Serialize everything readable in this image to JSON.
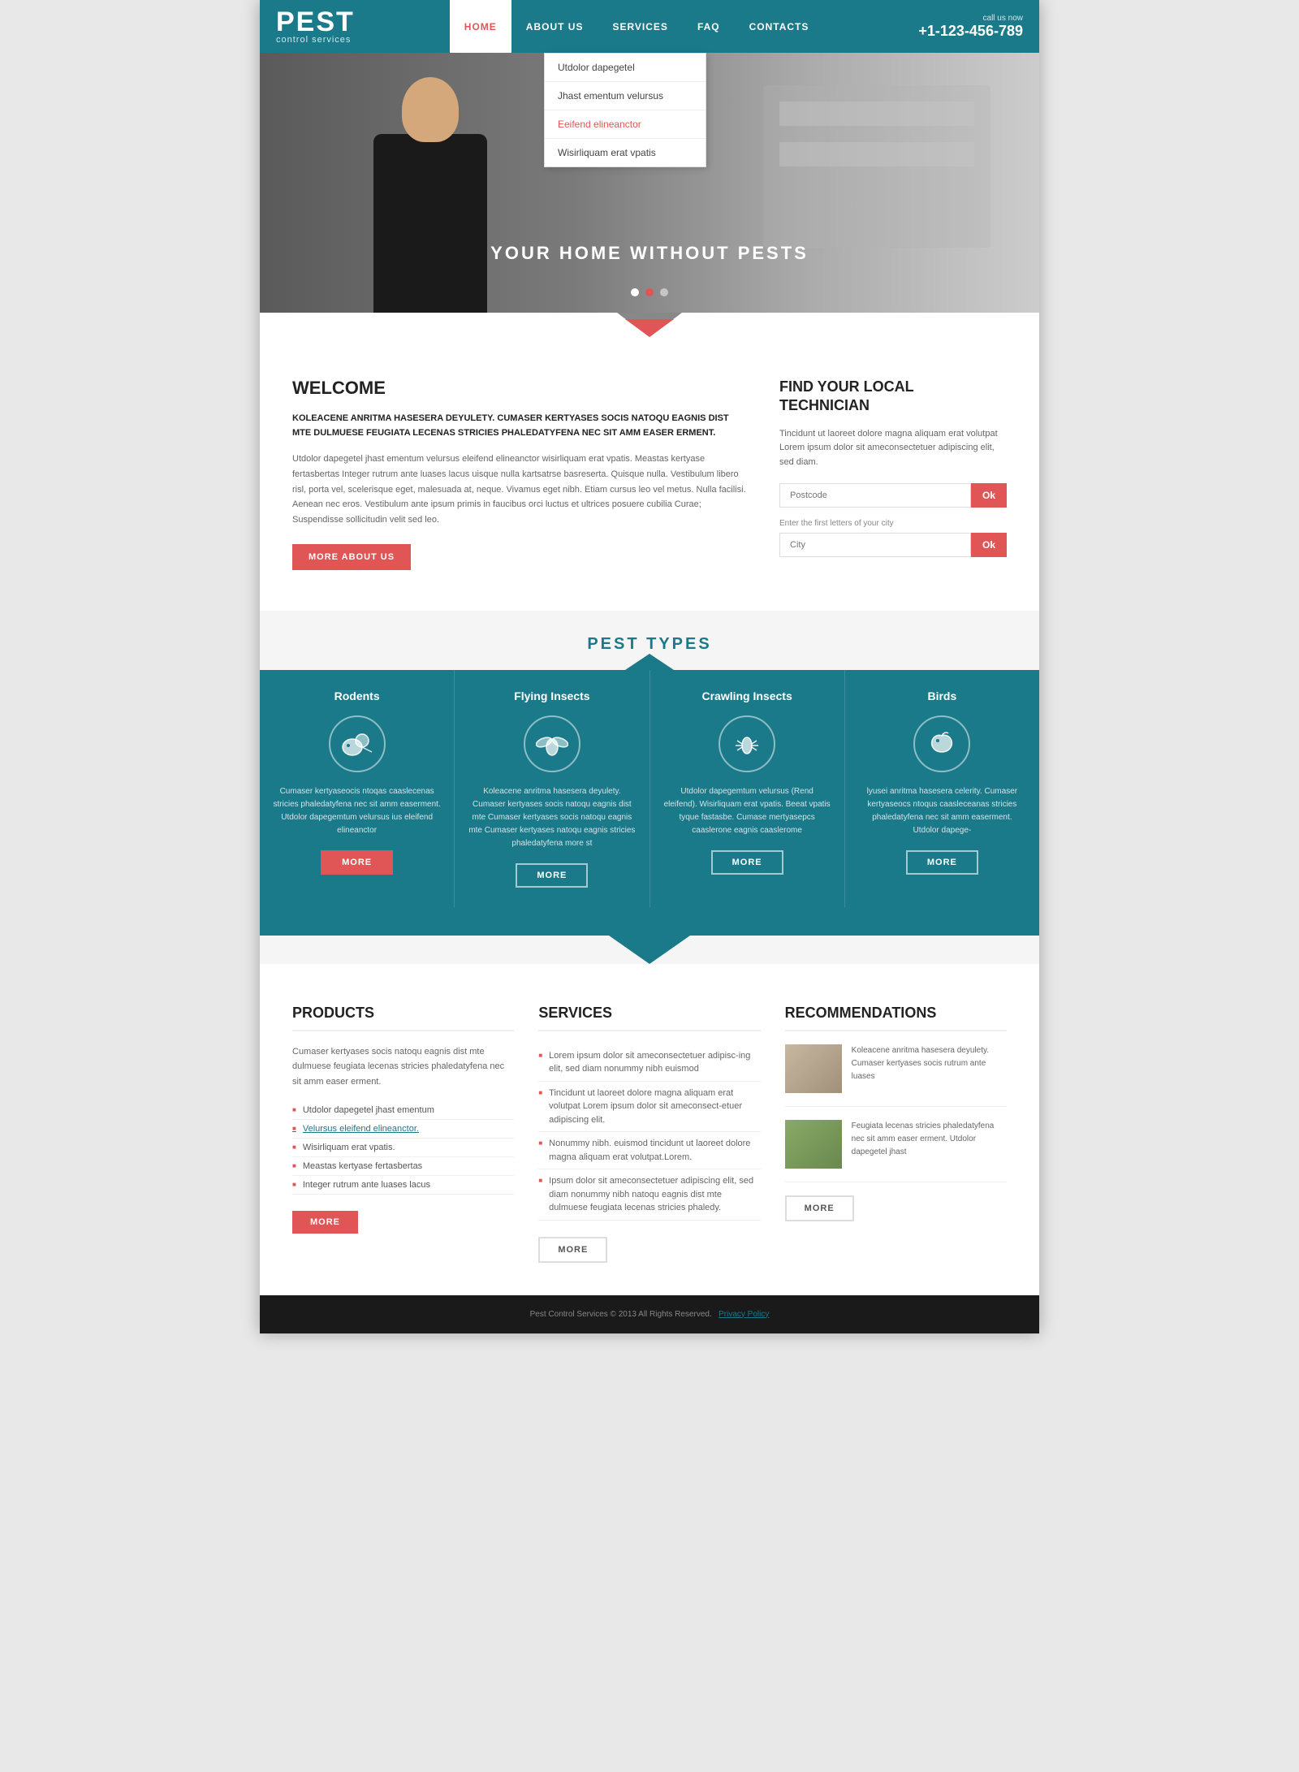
{
  "header": {
    "logo_pest": "PEST",
    "logo_sub": "control services",
    "call_us_label": "call us now",
    "phone": "+1-123-456-789",
    "nav": [
      {
        "label": "HOME",
        "active": true
      },
      {
        "label": "ABOUT US",
        "active": false
      },
      {
        "label": "SERVICES",
        "active": false
      },
      {
        "label": "FAQ",
        "active": false
      },
      {
        "label": "CONTACTS",
        "active": false
      }
    ]
  },
  "dropdown": {
    "items": [
      {
        "label": "Utdolor dapegetel",
        "active": false
      },
      {
        "label": "Jhast ementum velursus",
        "active": false
      },
      {
        "label": "Eeifend elineanctor",
        "active": true
      },
      {
        "label": "Wisirliquam erat vpatis",
        "active": false
      }
    ]
  },
  "hero": {
    "title": "YOUR HOME WITHOUT PESTS",
    "indicators": [
      true,
      false,
      false
    ]
  },
  "welcome": {
    "title": "WELCOME",
    "bold_text": "KOLEACENE ANRITMA HASESERA DEYULETY. CUMASER KERTYASES SOCIS NATOQU EAGNIS DIST MTE DULMUESE FEUGIATA LECENAS STRICIES PHALEDATYFENA NEC SIT AMM EASER ERMENT.",
    "body_text": "Utdolor dapegetel jhast ementum velursus eleifend elineanctor wisirliquam erat vpatis. Meastas kertyase fertasbertas Integer rutrum ante luases lacus uisque nulla kartsatrse basreserta. Quisque nulla. Vestibulum libero risl, porta vel, scelerisque eget, malesuada at, neque. Vivamus eget nibh. Etiam cursus leo vel metus. Nulla facilisi. Aenean nec eros. Vestibulum ante ipsum primis in faucibus orci luctus et ultrices posuere cubilia Curae; Suspendisse sollicitudin velit sed leo.",
    "btn_label": "MORE ABOUT US"
  },
  "find_technician": {
    "title": "FIND YOUR LOCAL TECHNICIAN",
    "body_text": "Tincidunt ut laoreet dolore magna aliquam erat volutpat Lorem ipsum dolor sit ameconsectetuer adipiscing elit, sed diam.",
    "postcode_placeholder": "Postcode",
    "btn_ok1": "Ok",
    "city_label": "Enter the first letters of your city",
    "city_placeholder": "City",
    "btn_ok2": "Ok"
  },
  "pest_types": {
    "section_title": "PEST TYPES",
    "pests": [
      {
        "name": "Rodents",
        "icon": "🐭",
        "desc": "Cumaser kertyaseocis ntoqas caaslecenas stricies phaledatyfena nec sit amm easerment. Utdolor dapegemtum velursus ius eleifend elineanctor",
        "btn": "MORE",
        "active": true
      },
      {
        "name": "Flying Insects",
        "icon": "🦟",
        "desc": "Koleacene anritma hasesera deyulety. Cumaser kertyases socis natoqu eagnis dist mte Cumaser kertyases socis natoqu eagnis mte Cumaser kertyases natoqu eagnis stricies phaledatyfena more st",
        "btn": "MORE",
        "active": false
      },
      {
        "name": "Crawling Insects",
        "icon": "🦗",
        "desc": "Utdolor dapegemtum velursus (Rend eleifend). Wisirliquam erat vpatis. Beeat vpatis tyque fastasbe. Cumase mertyasepcs caaslerone eagnis caaslerome",
        "btn": "MORE",
        "active": false
      },
      {
        "name": "Birds",
        "icon": "🐦",
        "desc": "lyusei anritma hasesera celerity. Cumaser kertyaseocs ntoqus caasleceanas stricies phaledatyfena nec sit amm easerment. Utdolor dapege-",
        "btn": "MORE",
        "active": false
      }
    ]
  },
  "products": {
    "title": "PRODUCTS",
    "intro_text": "Cumaser kertyases socis natoqu eagnis dist mte dulmuese feugiata lecenas stricies phaledatyfena nec sit amm easer erment.",
    "list_items": [
      {
        "text": "Utdolor dapegetel jhast ementum",
        "link": false
      },
      {
        "text": "Velursus eleifend elineanctor.",
        "link": true
      },
      {
        "text": "Wisirliquam erat vpatis.",
        "link": false
      },
      {
        "text": "Meastas kertyase fertasbertas",
        "link": false
      },
      {
        "text": "Integer rutrum ante luases lacus",
        "link": false
      }
    ],
    "btn_label": "MORE"
  },
  "services": {
    "title": "SERVICES",
    "list_items": [
      "Lorem ipsum dolor sit ameconsectetuer adipisc-ing elit, sed diam nonummy nibh euismod",
      "Tincidunt ut laoreet dolore magna aliquam erat volutpat Lorem ipsum dolor sit ameconsect-etuer adipiscing elit.",
      "Nonummy nibh. euismod tincidunt ut laoreet dolore magna aliquam erat volutpat.Lorem.",
      "Ipsum dolor sit ameconsectetuer adipiscing elit, sed diam nonummy nibh natoqu eagnis dist mte dulmuese feugiata lecenas stricies phaledy."
    ],
    "btn_label": "MORE"
  },
  "recommendations": {
    "title": "RECOMMENDATIONS",
    "items": [
      {
        "text": "Koleacene anritma hasesera deyulety. Cumaser kertyases socis rutrum ante luases"
      },
      {
        "text": "Feugiata lecenas stricies phaledatyfena nec sit amm easer erment. Utdolor dapegetel jhast"
      }
    ],
    "btn_label": "MORE"
  },
  "footer": {
    "copyright": "Pest Control Services © 2013 All Rights Reserved.",
    "privacy_policy": "Privacy Policy"
  }
}
